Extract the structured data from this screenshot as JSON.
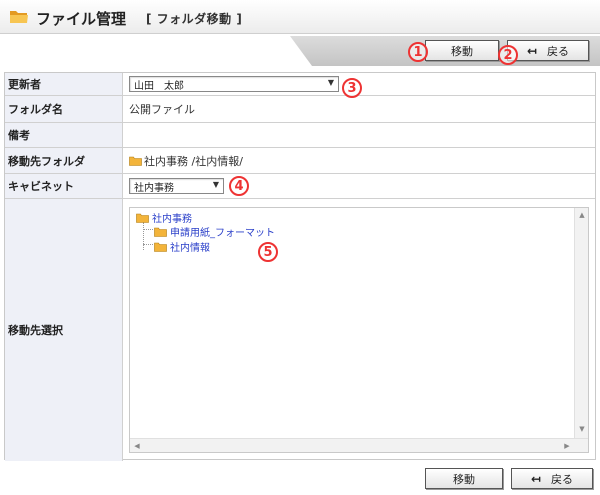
{
  "header": {
    "title": "ファイル管理",
    "subtitle": "[ フォルダ移動 ]"
  },
  "toolbar": {
    "move_label": "移動",
    "back_label": "戻る"
  },
  "markers": [
    "1",
    "2",
    "3",
    "4",
    "5"
  ],
  "form": {
    "updater": {
      "label": "更新者",
      "value": "山田　太郎"
    },
    "folder_name": {
      "label": "フォルダ名",
      "value": "公開ファイル"
    },
    "remarks": {
      "label": "備考",
      "value": ""
    },
    "destination_folder": {
      "label": "移動先フォルダ",
      "value": "社内事務 /社内情報/"
    },
    "cabinet": {
      "label": "キャビネット",
      "value": "社内事務"
    },
    "destination_select": {
      "label": "移動先選択",
      "tree": [
        {
          "label": "社内事務",
          "level": 0
        },
        {
          "label": "申請用紙_フォーマット",
          "level": 1
        },
        {
          "label": "社内情報",
          "level": 1
        }
      ]
    }
  },
  "footer": {
    "move_label": "移動",
    "back_label": "戻る"
  },
  "colors": {
    "label_bg": "#eef0f7",
    "link": "#2a3fc9",
    "marker": "#e33333",
    "folder": "#f3b43a"
  },
  "icons": [
    "folder-icon",
    "back-arrow-icon",
    "dropdown-caret-icon",
    "scroll-up-icon",
    "scroll-down-icon"
  ]
}
